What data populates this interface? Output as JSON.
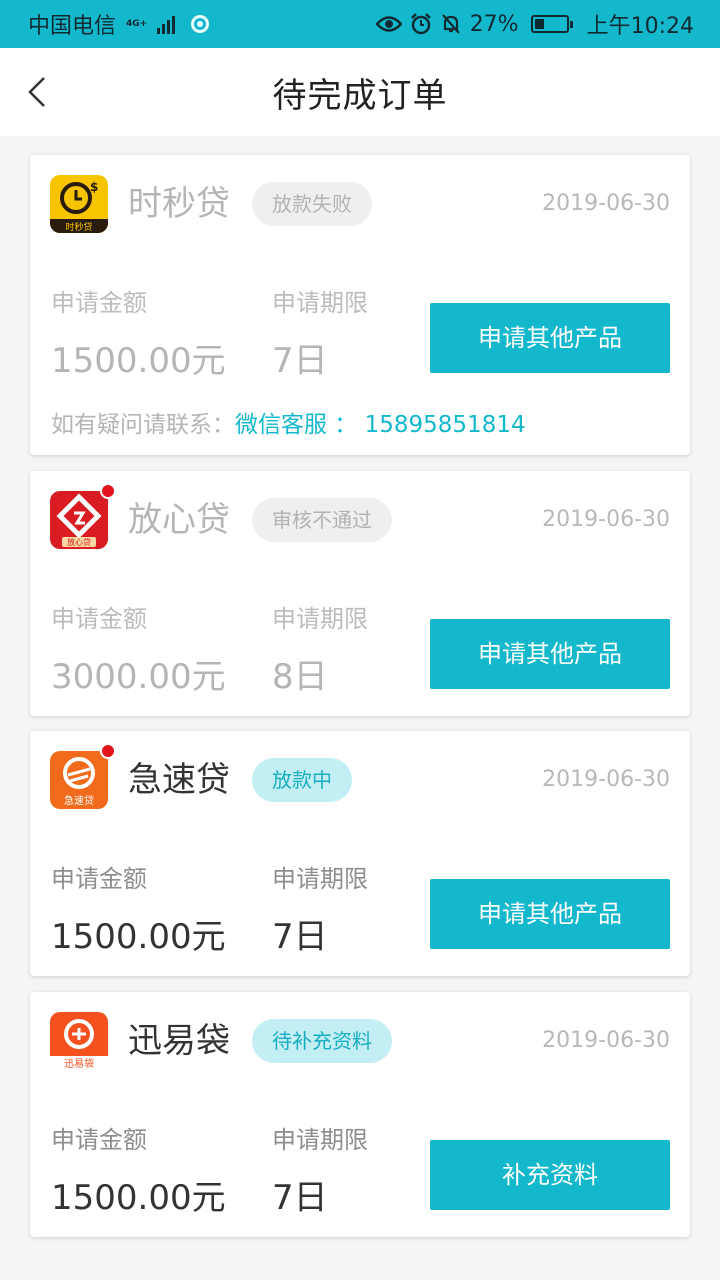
{
  "status_bar": {
    "carrier": "中国电信",
    "network": "4G+",
    "battery": "27%",
    "time": "上午10:24"
  },
  "nav": {
    "title": "待完成订单"
  },
  "orders": [
    {
      "product": "时秒贷",
      "logo_text": "时秒贷",
      "status": "放款失败",
      "date": "2019-06-30",
      "amount_label": "申请金额",
      "amount": "1500.00元",
      "term_label": "申请期限",
      "term": "7日",
      "action": "申请其他产品",
      "contact_prefix": "如有疑问请联系：",
      "contact_link": "微信客服 ： 15895851814"
    },
    {
      "product": "放心贷",
      "logo_text": "放心贷",
      "status": "审核不通过",
      "date": "2019-06-30",
      "amount_label": "申请金额",
      "amount": "3000.00元",
      "term_label": "申请期限",
      "term": "8日",
      "action": "申请其他产品"
    },
    {
      "product": "急速贷",
      "logo_text": "急速贷",
      "status": "放款中",
      "date": "2019-06-30",
      "amount_label": "申请金额",
      "amount": "1500.00元",
      "term_label": "申请期限",
      "term": "7日",
      "action": "申请其他产品"
    },
    {
      "product": "迅易袋",
      "logo_text": "迅易袋",
      "status": "待补充资料",
      "date": "2019-06-30",
      "amount_label": "申请金额",
      "amount": "1500.00元",
      "term_label": "申请期限",
      "term": "7日",
      "action": "补充资料"
    }
  ],
  "colors": {
    "accent": "#14b8cc",
    "badge_blue_bg": "#c3eef3",
    "badge_gray_bg": "#efefef",
    "notify_dot": "#e3141d"
  }
}
